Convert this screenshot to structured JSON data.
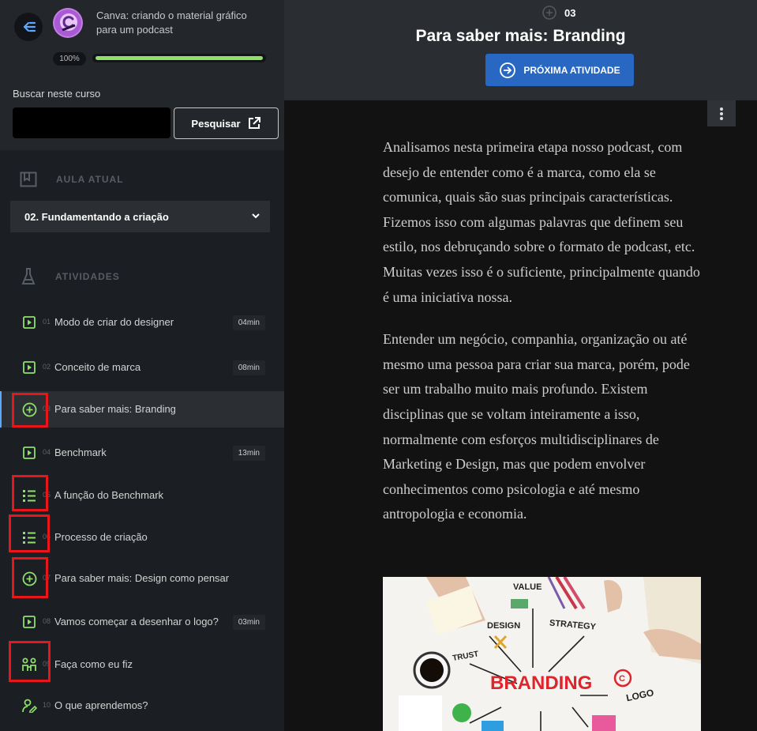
{
  "sidebar": {
    "course_title": "Canva: criando o material gráfico para um podcast",
    "progress_text": "100%",
    "progress_value": 1.0,
    "search_label": "Buscar neste curso",
    "search_value": "",
    "search_button": "Pesquisar",
    "current_lesson_heading": "AULA ATUAL",
    "current_lesson": "02. Fundamentando a criação",
    "activities_heading": "ATIVIDADES",
    "activities": [
      {
        "num": "01",
        "label": "Modo de criar do designer",
        "duration": "04min",
        "icon": "video-icon"
      },
      {
        "num": "02",
        "label": "Conceito de marca",
        "duration": "08min",
        "icon": "video-icon"
      },
      {
        "num": "03",
        "label": "Para saber mais: Branding",
        "duration": "",
        "icon": "plus-circle-icon"
      },
      {
        "num": "04",
        "label": "Benchmark",
        "duration": "13min",
        "icon": "video-icon"
      },
      {
        "num": "05",
        "label": "A função do Benchmark",
        "duration": "",
        "icon": "list-icon"
      },
      {
        "num": "06",
        "label": "Processo de criação",
        "duration": "",
        "icon": "list-icon"
      },
      {
        "num": "07",
        "label": "Para saber mais: Design como pensar",
        "duration": "",
        "icon": "plus-circle-icon"
      },
      {
        "num": "08",
        "label": "Vamos começar a desenhar o logo?",
        "duration": "03min",
        "icon": "video-icon"
      },
      {
        "num": "09",
        "label": "Faça como eu fiz",
        "duration": "",
        "icon": "people-icon"
      },
      {
        "num": "10",
        "label": "O que aprendemos?",
        "duration": "",
        "icon": "user-edit-icon"
      }
    ]
  },
  "header": {
    "activity_number": "03",
    "title": "Para saber mais: Branding",
    "next_button": "PRÓXIMA ATIVIDADE"
  },
  "content": {
    "paragraphs": [
      "Analisamos nesta primeira etapa nosso podcast, com desejo de entender como é a marca, como ela se comunica, quais são suas principais características. Fizemos isso com algumas palavras que definem seu estilo, nos debruçando sobre o formato de podcast, etc. Muitas vezes isso é o suficiente, principalmente quando é uma iniciativa nossa.",
      "Entender um negócio, companhia, organização ou até mesmo uma pessoa para criar sua marca, porém, pode ser um trabalho muito mais profundo. Existem disciplinas que se voltam inteiramente a isso, normalmente com esforços multidisciplinares de Marketing e Design, mas que podem envolver conhecimentos como psicologia e até mesmo antropologia e economia."
    ],
    "image_words": {
      "value": "VALUE",
      "design": "DESIGN",
      "strategy": "STRATEGY",
      "trust": "TRUST",
      "branding": "BRANDING",
      "logo": "LOGO"
    }
  },
  "colors": {
    "accent_green": "#8ee06b",
    "primary_blue": "#2868c2",
    "highlight_red": "#e8151b",
    "sidebar_bg": "#1b1e22"
  }
}
